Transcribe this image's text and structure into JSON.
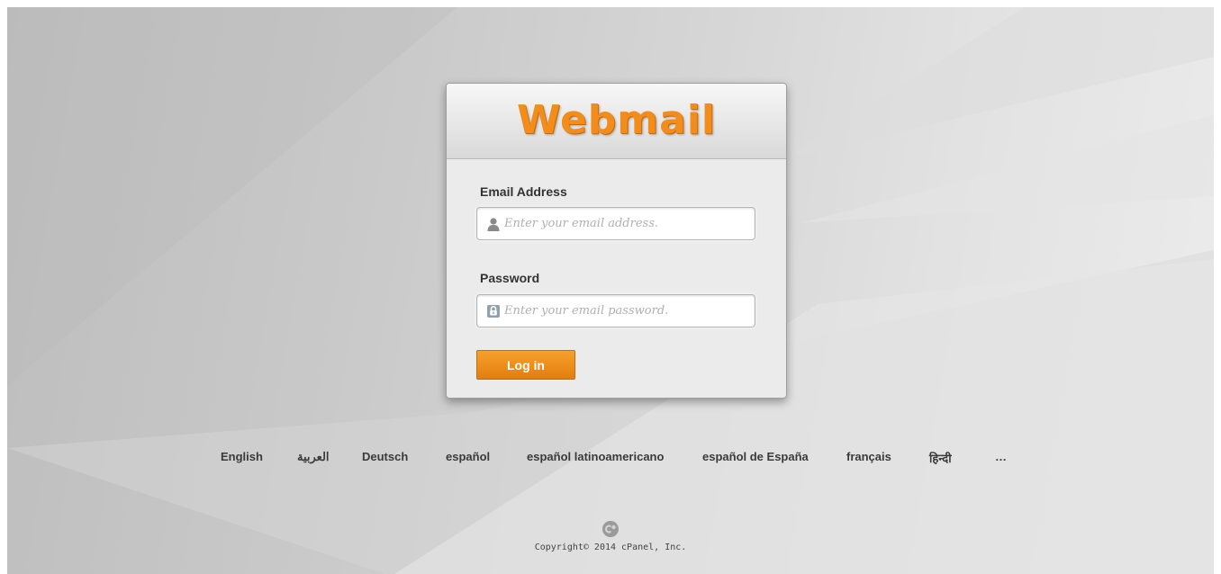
{
  "header": {
    "logo_text": "Webmail"
  },
  "form": {
    "email": {
      "label": "Email Address",
      "placeholder": "Enter your email address.",
      "value": "",
      "icon": "user-icon"
    },
    "password": {
      "label": "Password",
      "placeholder": "Enter your email password.",
      "value": "",
      "icon": "lock-icon"
    },
    "login_label": "Log in"
  },
  "languages": {
    "english": "English",
    "arabic": "العربية",
    "deutsch": "Deutsch",
    "espanol": "español",
    "espanol_latam": "español latinoamericano",
    "espanol_es": "español de España",
    "francais": "français",
    "hindi": "हिन्दी",
    "more": "…"
  },
  "footer": {
    "logo": "cpanel-logo",
    "copyright": "Copyright© 2014 cPanel, Inc."
  },
  "colors": {
    "accent": "#f28c1b",
    "button": "#e8840f",
    "background": "#cccccc"
  }
}
